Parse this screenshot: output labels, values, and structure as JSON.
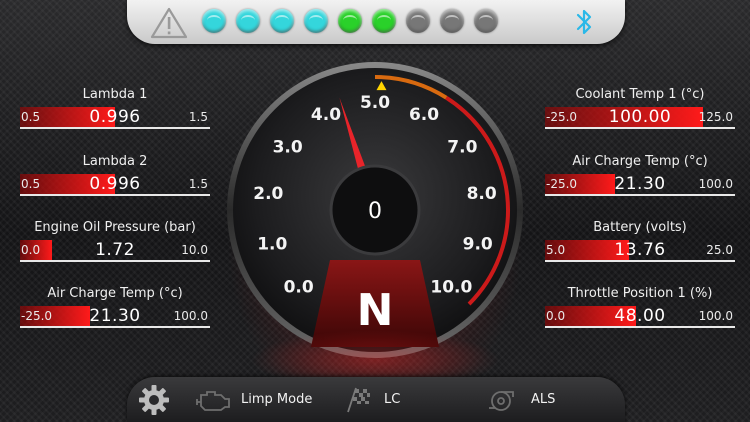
{
  "colors": {
    "cyan_led": "#34d6dc",
    "green_led": "#2ad12a",
    "off_led": "#777777",
    "fill_red": "#ff1a1a",
    "needle": "#e8242a",
    "shift_orange": "#d86a10",
    "bluetooth": "#2ab8e8"
  },
  "status_bar": {
    "warning_icon": "warning-triangle-icon",
    "leds": [
      "cyan",
      "cyan",
      "cyan",
      "cyan",
      "green",
      "green",
      "off",
      "off",
      "off"
    ],
    "bluetooth_icon": "bluetooth-icon"
  },
  "left_gauges": [
    {
      "title": "Lambda 1",
      "min": "0.5",
      "value": "0.996",
      "max": "1.5",
      "fill": 0.5
    },
    {
      "title": "Lambda 2",
      "min": "0.5",
      "value": "0.996",
      "max": "1.5",
      "fill": 0.5
    },
    {
      "title": "Engine Oil Pressure (bar)",
      "min": "0.0",
      "value": "1.72",
      "max": "10.0",
      "fill": 0.17
    },
    {
      "title": "Air Charge Temp (°c)",
      "min": "-25.0",
      "value": "21.30",
      "max": "100.0",
      "fill": 0.37
    }
  ],
  "right_gauges": [
    {
      "title": "Coolant Temp 1 (°c)",
      "min": "-25.0",
      "value": "100.00",
      "max": "125.0",
      "fill": 0.83
    },
    {
      "title": "Air Charge Temp (°c)",
      "min": "-25.0",
      "value": "21.30",
      "max": "100.0",
      "fill": 0.37
    },
    {
      "title": "Battery (volts)",
      "min": "5.0",
      "value": "13.76",
      "max": "25.0",
      "fill": 0.44
    },
    {
      "title": "Throttle Position 1 (%)",
      "min": "0.0",
      "value": "48.00",
      "max": "100.0",
      "fill": 0.48
    }
  ],
  "tach": {
    "ticks": [
      "0.0",
      "1.0",
      "2.0",
      "3.0",
      "4.0",
      "5.0",
      "6.0",
      "7.0",
      "8.0",
      "9.0",
      "10.0"
    ],
    "rpm_value": 4.35,
    "center_readout": "0",
    "gear": "N",
    "shift_marker_value": 5.0
  },
  "bottom_bar": {
    "settings_icon": "gear-icon",
    "limp_mode_label": "Limp Mode",
    "limp_mode_icon": "engine-icon",
    "lc_label": "LC",
    "lc_icon": "checkered-flag-icon",
    "als_label": "ALS",
    "als_icon": "turbo-icon"
  }
}
